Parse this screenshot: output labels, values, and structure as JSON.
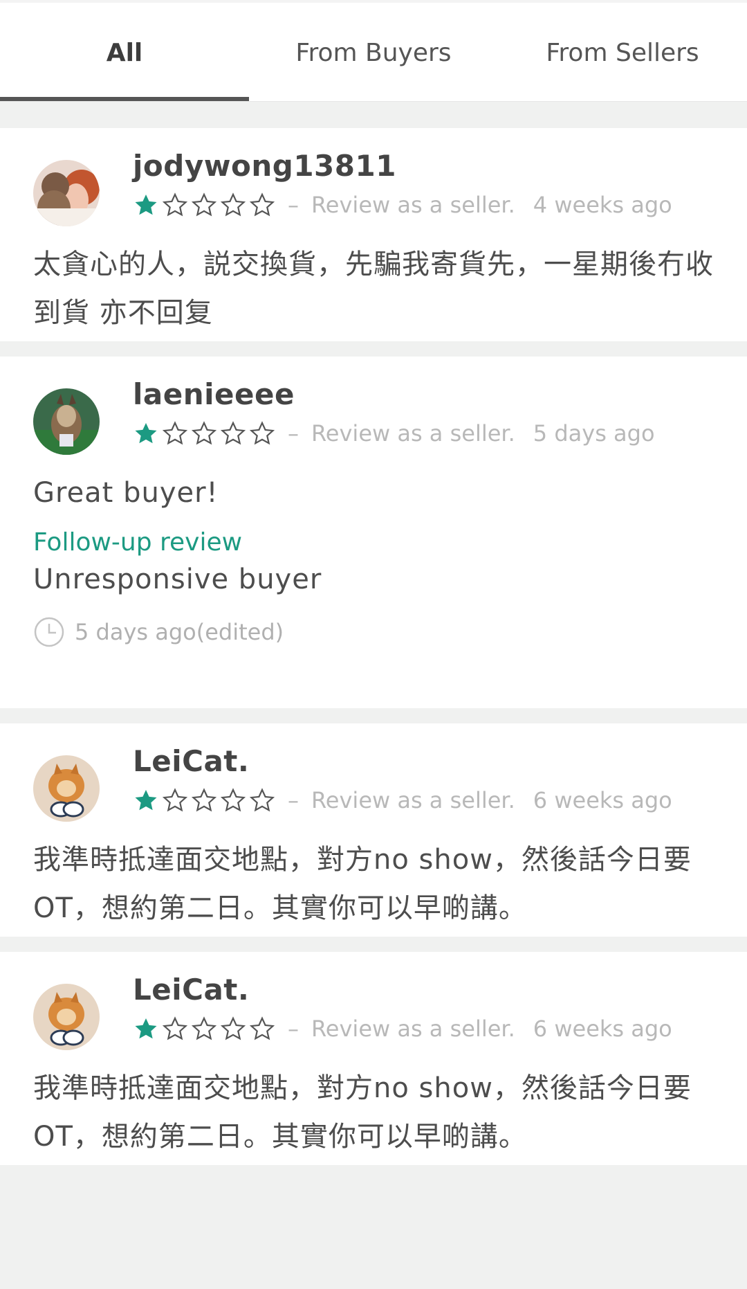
{
  "tabs": [
    {
      "label": "All",
      "active": true
    },
    {
      "label": "From Buyers",
      "active": false
    },
    {
      "label": "From Sellers",
      "active": false
    }
  ],
  "reviews": [
    {
      "username": "jodywong13811",
      "rating": 1,
      "max_rating": 5,
      "role": "Review as a seller.",
      "time": "4 weeks ago",
      "text": "太貪心的人，説交換貨，先騙我寄貨先，一星期後冇收到貨 亦不回复"
    },
    {
      "username": "laenieeee",
      "rating": 1,
      "max_rating": 5,
      "role": "Review as a seller.",
      "time": "5 days ago",
      "text": "Great buyer!",
      "followup_label": "Follow-up review",
      "followup_text": "Unresponsive buyer",
      "edited_time": "5 days ago(edited)"
    },
    {
      "username": "LeiCat.",
      "rating": 1,
      "max_rating": 5,
      "role": "Review as a seller.",
      "time": "6 weeks ago",
      "text": "我準時抵達面交地點，對方no show，然後話今日要OT，想約第二日。其實你可以早啲講。"
    },
    {
      "username": "LeiCat.",
      "rating": 1,
      "max_rating": 5,
      "role": "Review as a seller.",
      "time": "6 weeks ago",
      "text": "我準時抵達面交地點，對方no show，然後話今日要OT，想約第二日。其實你可以早啲講。"
    }
  ],
  "icons": {
    "star_filled": "star-filled-icon",
    "star_empty": "star-outline-icon",
    "clock": "clock-icon"
  },
  "colors": {
    "star": "#1c9a82",
    "followup": "#1c9a82",
    "tab_indicator": "#555555"
  }
}
